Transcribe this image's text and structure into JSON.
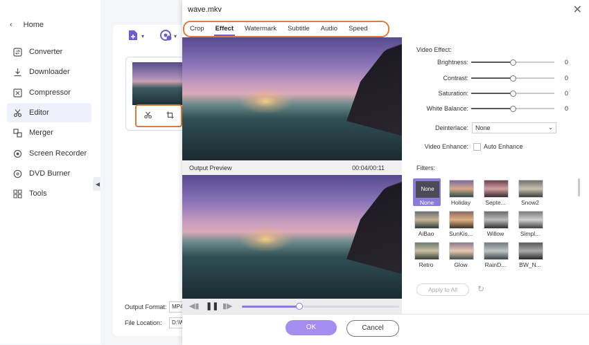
{
  "sidebar": {
    "home_label": "Home",
    "items": [
      {
        "label": "Converter",
        "icon": "converter-icon"
      },
      {
        "label": "Downloader",
        "icon": "downloader-icon"
      },
      {
        "label": "Compressor",
        "icon": "compressor-icon"
      },
      {
        "label": "Editor",
        "icon": "editor-icon",
        "active": true
      },
      {
        "label": "Merger",
        "icon": "merger-icon"
      },
      {
        "label": "Screen Recorder",
        "icon": "screen-recorder-icon"
      },
      {
        "label": "DVD Burner",
        "icon": "dvd-burner-icon"
      },
      {
        "label": "Tools",
        "icon": "tools-icon"
      }
    ]
  },
  "main": {
    "output_format_label": "Output Format:",
    "output_format_value": "MP4",
    "file_location_label": "File Location:",
    "file_location_value": "D:\\W"
  },
  "dialog": {
    "title": "wave.mkv",
    "tabs": [
      "Crop",
      "Effect",
      "Watermark",
      "Subtitle",
      "Audio",
      "Speed"
    ],
    "active_tab": "Effect",
    "output_preview_label": "Output Preview",
    "time": "00:04/00:11",
    "playback_progress": 0.36,
    "video_effect_label": "Video Effect:",
    "sliders": [
      {
        "label": "Brightness:",
        "value": "0",
        "level": 0.5
      },
      {
        "label": "Contrast:",
        "value": "0",
        "level": 0.5
      },
      {
        "label": "Saturation:",
        "value": "0",
        "level": 0.5
      },
      {
        "label": "White Balance:",
        "value": "0",
        "level": 0.5
      }
    ],
    "deinterlace_label": "Deinterlace:",
    "deinterlace_value": "None",
    "video_enhance_label": "Video Enhance:",
    "auto_enhance_label": "Auto Enhance",
    "filters_label": "Filters:",
    "filters": [
      {
        "label": "None",
        "selected": true,
        "thumb_text": "None"
      },
      {
        "label": "Holiday"
      },
      {
        "label": "Septe..."
      },
      {
        "label": "Snow2"
      },
      {
        "label": "AiBao"
      },
      {
        "label": "SunKis..."
      },
      {
        "label": "Willow"
      },
      {
        "label": "Simpl..."
      },
      {
        "label": "Retro"
      },
      {
        "label": "Glow"
      },
      {
        "label": "RainD..."
      },
      {
        "label": "BW_N..."
      }
    ],
    "apply_all_label": "Apply to All",
    "ok_label": "OK",
    "cancel_label": "Cancel"
  },
  "colors": {
    "accent": "#8b7ad8",
    "highlight": "#e07a36",
    "ok_button": "#a58df0"
  }
}
